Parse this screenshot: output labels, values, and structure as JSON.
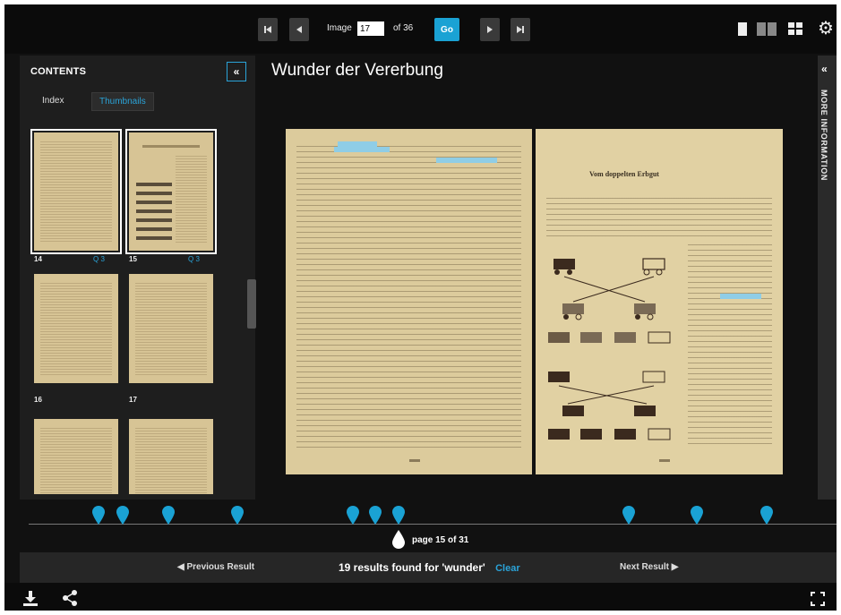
{
  "toolbar": {
    "first_icon": "first-page-icon",
    "prev_icon": "prev-page-icon",
    "image_label": "Image",
    "image_value": "17",
    "of_label": "of 36",
    "go_label": "Go",
    "next_icon": "next-page-icon",
    "last_icon": "last-page-icon",
    "view_icons": [
      "single-page-view-icon",
      "two-page-view-icon",
      "grid-view-icon"
    ],
    "settings_icon": "gear-icon"
  },
  "contents": {
    "title": "CONTENTS",
    "collapse_label": "«",
    "tabs": [
      {
        "label": "Index",
        "active": false
      },
      {
        "label": "Thumbnails",
        "active": true
      }
    ],
    "thumbnails": [
      {
        "page": "14",
        "hits": "Q 3"
      },
      {
        "page": "15",
        "hits": "Q 3"
      },
      {
        "page": "16",
        "hits": ""
      },
      {
        "page": "17",
        "hits": ""
      }
    ]
  },
  "document": {
    "title": "Wunder der Vererbung",
    "right_page_heading": "Vom doppelten Erbgut"
  },
  "info_panel": {
    "collapse_label": "«",
    "label": "MORE INFORMATION"
  },
  "timeline": {
    "pin_count": 11,
    "page_indicator": "page 15 of 31",
    "current_position": 0.45
  },
  "results": {
    "previous_label": "◀ Previous Result",
    "summary": "19 results found for 'wunder'",
    "clear_label": "Clear",
    "next_label": "Next Result ▶"
  },
  "bottom": {
    "download_icon": "download-icon",
    "share_icon": "share-icon",
    "fullscreen_icon": "fullscreen-icon"
  },
  "colors": {
    "accent": "#1aa2d4",
    "page": "#dccb9c",
    "background": "#111111"
  }
}
